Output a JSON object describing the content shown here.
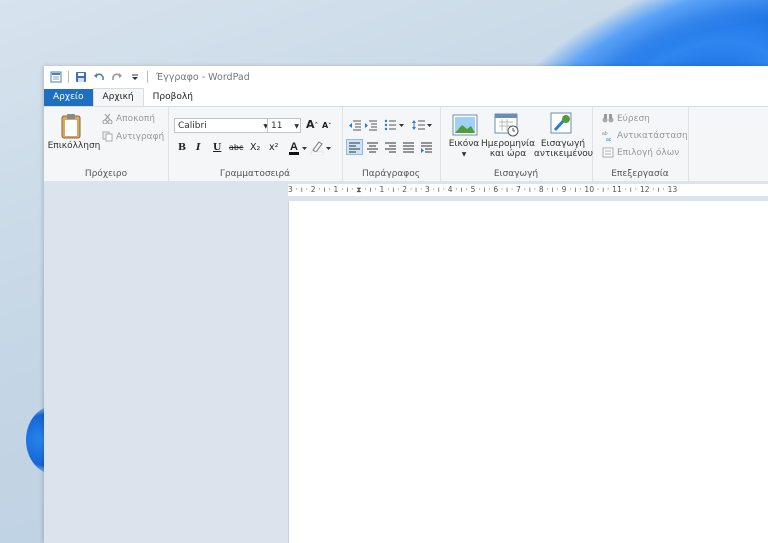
{
  "window": {
    "title": "Έγγραφο - WordPad"
  },
  "tabs": {
    "file": "Αρχείο",
    "home": "Αρχική",
    "view": "Προβολή"
  },
  "clipboard": {
    "paste": "Επικόλληση",
    "cut": "Αποκοπή",
    "copy": "Αντιγραφή",
    "label": "Πρόχειρο"
  },
  "font": {
    "family": "Calibri",
    "size": "11",
    "bold": "B",
    "italic": "I",
    "underline": "U",
    "strike": "abc",
    "subscript": "X₂",
    "superscript": "x²",
    "label": "Γραμματοσειρά"
  },
  "paragraph": {
    "label": "Παράγραφος"
  },
  "insert": {
    "picture": "Εικόνα",
    "datetime_1": "Ημερομηνία",
    "datetime_2": "και ώρα",
    "object_1": "Εισαγωγή",
    "object_2": "αντικειμένου",
    "label": "Εισαγωγή"
  },
  "editing": {
    "find": "Εύρεση",
    "replace": "Αντικατάσταση",
    "select_all": "Επιλογή όλων",
    "label": "Επεξεργασία"
  },
  "ruler": {
    "text": "3 · ı · 2 · ı · 1 · ı · ⧗ · ı · 1 · ı · 2 · ı · 3 · ı · 4 · ı · 5 · ı · 6 · ı · 7 · ı · 8 · ı · 9 · ı · 10 · ı · 11 · ı · 12 · ı · 13"
  },
  "colors": {
    "file_tab": "#1e6fc2",
    "accent": "#2b7bd6"
  }
}
